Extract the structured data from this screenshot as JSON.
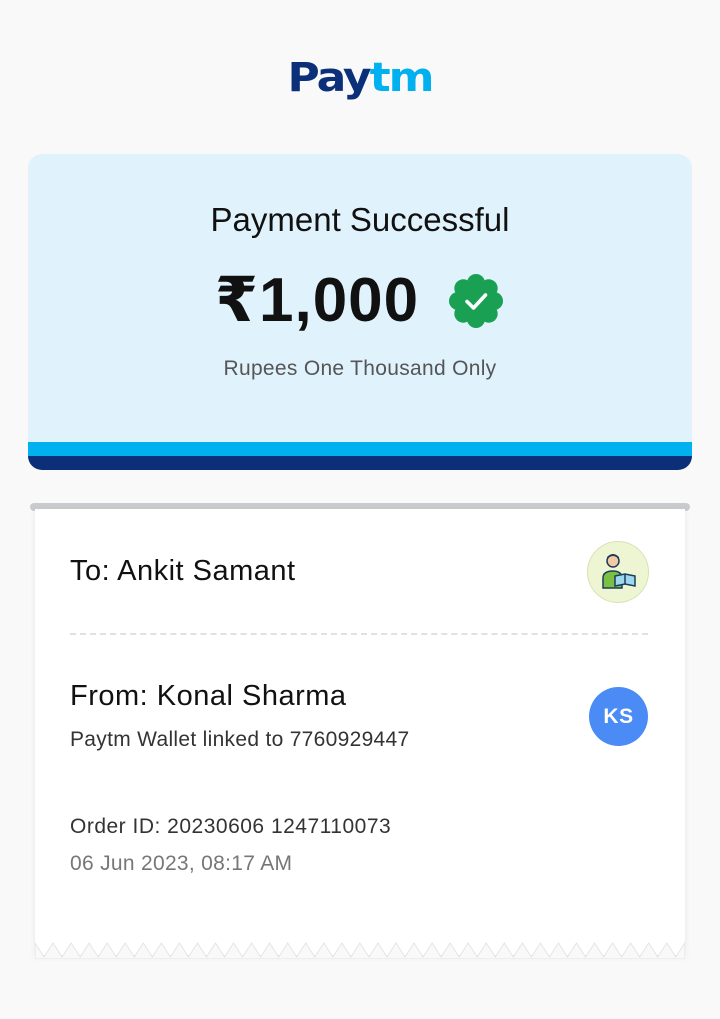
{
  "brand": {
    "logo_part1": "Pay",
    "logo_part2": "tm"
  },
  "status": {
    "title": "Payment Successful",
    "amount": "₹1,000",
    "amount_in_words": "Rupees One Thousand Only",
    "badge_icon": "verified-check-icon"
  },
  "receiver": {
    "label": "To: Ankit Samant",
    "avatar_icon": "user-reading-icon"
  },
  "sender": {
    "label": "From: Konal Sharma",
    "wallet_info": "Paytm Wallet linked to 7760929447",
    "initials": "KS"
  },
  "transaction": {
    "order_id": "Order ID: 20230606 1247110073",
    "timestamp": "06 Jun 2023, 08:17 AM"
  },
  "colors": {
    "brand_dark": "#0b2f78",
    "brand_light": "#00b0ef",
    "success_bg": "#e0f3fc",
    "verified_green": "#1aa053",
    "avatar_blue": "#4a8bf5"
  }
}
